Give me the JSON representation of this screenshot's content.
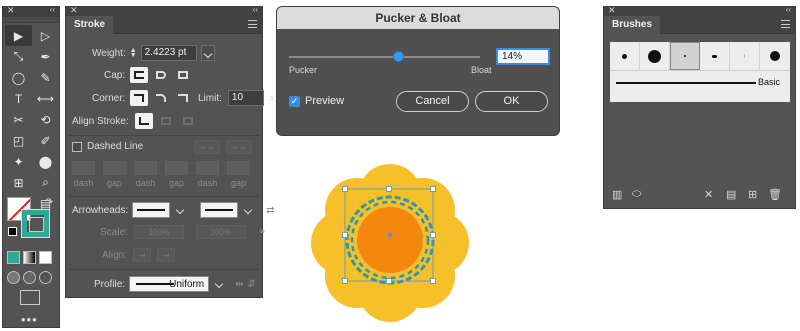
{
  "tools_panel": {
    "close_label": "✕",
    "collapse_label": "‹‹",
    "tools": [
      {
        "name": "selection-tool-icon",
        "glyph": "▶"
      },
      {
        "name": "direct-selection-tool-icon",
        "glyph": "▷"
      },
      {
        "name": "curvature-tool-icon",
        "glyph": "⤡"
      },
      {
        "name": "pen-tool-icon",
        "glyph": "✒"
      },
      {
        "name": "ellipse-tool-icon",
        "glyph": "◯"
      },
      {
        "name": "pencil-tool-icon",
        "glyph": "✎"
      },
      {
        "name": "type-tool-icon",
        "glyph": "T"
      },
      {
        "name": "reflect-tool-icon",
        "glyph": "⟷"
      },
      {
        "name": "scissors-tool-icon",
        "glyph": "✂"
      },
      {
        "name": "rotate-tool-icon",
        "glyph": "⟲"
      },
      {
        "name": "scale-tool-icon",
        "glyph": "◰"
      },
      {
        "name": "eyedropper-tool-icon",
        "glyph": "✐"
      },
      {
        "name": "puppet-warp-tool-icon",
        "glyph": "✦"
      },
      {
        "name": "blend-tool-icon",
        "glyph": "⬤"
      },
      {
        "name": "artboard-tool-icon",
        "glyph": "⊞"
      },
      {
        "name": "zoom-tool-icon",
        "glyph": "⌕"
      },
      {
        "name": "hand-tool-icon",
        "glyph": "✋"
      },
      {
        "name": "gradient-tool-icon",
        "glyph": "▤"
      }
    ],
    "swap_label": "↷",
    "more_label": "•••"
  },
  "stroke_panel": {
    "close_label": "✕",
    "collapse_label": "‹‹",
    "tab_label": "Stroke",
    "weight_label": "Weight:",
    "weight_value": "2.4223 pt",
    "cap_label": "Cap:",
    "corner_label": "Corner:",
    "limit_label": "Limit:",
    "limit_value": "10",
    "limit_unit": "x",
    "align_label": "Align Stroke:",
    "dashed_label": "Dashed Line",
    "dash_labels": [
      "dash",
      "gap",
      "dash",
      "gap",
      "dash",
      "gap"
    ],
    "arrowheads_label": "Arrowheads:",
    "scale_label": "Scale:",
    "scale_values": [
      "100%",
      "100%"
    ],
    "align_arrow_label": "Align:",
    "profile_label": "Profile:",
    "profile_value": "Uniform"
  },
  "dialog": {
    "title": "Pucker & Bloat",
    "amount_value": "14%",
    "amount_percent": 14,
    "pucker_label": "Pucker",
    "bloat_label": "Bloat",
    "preview_label": "Preview",
    "preview_checked": true,
    "cancel_label": "Cancel",
    "ok_label": "OK"
  },
  "brushes_panel": {
    "close_label": "✕",
    "collapse_label": "‹‹",
    "tab_label": "Brushes",
    "basic_label": "Basic"
  },
  "colors": {
    "accent": "#3b8be0",
    "petal": "#f6c02a",
    "center": "#f3870f",
    "ring": "#2f97a7"
  }
}
